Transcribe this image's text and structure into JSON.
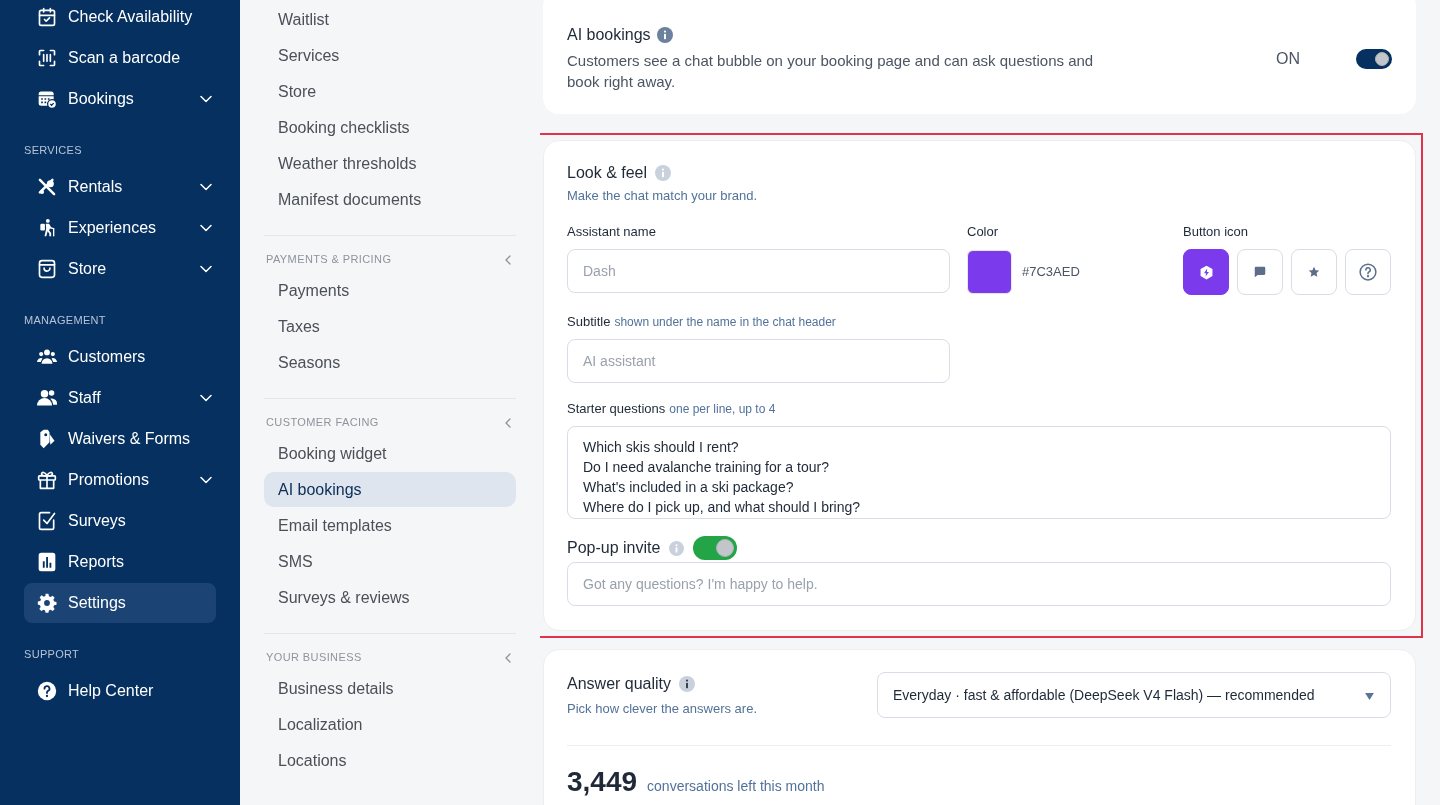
{
  "sidebar": {
    "sections": [
      {
        "items": [
          {
            "label": "Check Availability",
            "expandable": false,
            "selected": false
          },
          {
            "label": "Scan a barcode",
            "expandable": false,
            "selected": false
          },
          {
            "label": "Bookings",
            "expandable": true,
            "selected": false
          }
        ]
      },
      {
        "heading": "SERVICES",
        "items": [
          {
            "label": "Rentals",
            "expandable": true,
            "selected": false
          },
          {
            "label": "Experiences",
            "expandable": true,
            "selected": false
          },
          {
            "label": "Store",
            "expandable": true,
            "selected": false
          }
        ]
      },
      {
        "heading": "MANAGEMENT",
        "items": [
          {
            "label": "Customers",
            "expandable": false,
            "selected": false
          },
          {
            "label": "Staff",
            "expandable": true,
            "selected": false
          },
          {
            "label": "Waivers & Forms",
            "expandable": false,
            "selected": false
          },
          {
            "label": "Promotions",
            "expandable": true,
            "selected": false
          },
          {
            "label": "Surveys",
            "expandable": false,
            "selected": false
          },
          {
            "label": "Reports",
            "expandable": false,
            "selected": false
          },
          {
            "label": "Settings",
            "expandable": false,
            "selected": true
          }
        ]
      },
      {
        "heading": "SUPPORT",
        "items": [
          {
            "label": "Help Center",
            "expandable": false,
            "selected": false
          }
        ]
      }
    ]
  },
  "settings_nav": {
    "groups": [
      {
        "items": [
          {
            "label": "Waitlist",
            "selected": false
          },
          {
            "label": "Services",
            "selected": false
          },
          {
            "label": "Store",
            "selected": false
          },
          {
            "label": "Booking checklists",
            "selected": false
          },
          {
            "label": "Weather thresholds",
            "selected": false
          },
          {
            "label": "Manifest documents",
            "selected": false
          }
        ]
      },
      {
        "heading": "PAYMENTS & PRICING",
        "items": [
          {
            "label": "Payments",
            "selected": false
          },
          {
            "label": "Taxes",
            "selected": false
          },
          {
            "label": "Seasons",
            "selected": false
          }
        ]
      },
      {
        "heading": "CUSTOMER FACING",
        "items": [
          {
            "label": "Booking widget",
            "selected": false
          },
          {
            "label": "AI bookings",
            "selected": true
          },
          {
            "label": "Email templates",
            "selected": false
          },
          {
            "label": "SMS",
            "selected": false
          },
          {
            "label": "Surveys & reviews",
            "selected": false
          }
        ]
      },
      {
        "heading": "YOUR BUSINESS",
        "items": [
          {
            "label": "Business details",
            "selected": false
          },
          {
            "label": "Localization",
            "selected": false
          },
          {
            "label": "Locations",
            "selected": false
          }
        ]
      }
    ]
  },
  "ai_bookings": {
    "title": "AI bookings",
    "description": "Customers see a chat bubble on your booking page and can ask questions and book right away.",
    "toggle_label": "ON",
    "on": true
  },
  "look_and_feel": {
    "highlighted": true,
    "title": "Look & feel",
    "subtitle": "Make the chat match your brand.",
    "assistant_name": {
      "label": "Assistant name",
      "placeholder": "Dash"
    },
    "color": {
      "label": "Color",
      "value": "#7C3AED",
      "color": "#7c3aed"
    },
    "button_icon": {
      "label": "Button icon",
      "options": [
        {
          "selected": true
        },
        {
          "selected": false
        },
        {
          "selected": false
        },
        {
          "selected": false
        }
      ]
    },
    "subtitle_field": {
      "label": "Subtitle",
      "hint": "shown under the name in the chat header",
      "placeholder": "AI assistant"
    },
    "starter_questions": {
      "label": "Starter questions",
      "hint": "one per line, up to 4",
      "lines": [
        "Which skis should I rent?",
        "Do I need avalanche training for a tour?",
        "What's included in a ski package?",
        "Where do I pick up, and what should I bring?"
      ]
    },
    "popup_invite": {
      "label": "Pop-up invite",
      "on": true,
      "placeholder": "Got any questions? I'm happy to help."
    }
  },
  "answer_quality": {
    "title": "Answer quality",
    "subtitle": "Pick how clever the answers are.",
    "value": "Everyday · fast & affordable (DeepSeek V4 Flash) — recommended",
    "remaining_count": "3,449",
    "remaining_label": "conversations left this month"
  }
}
